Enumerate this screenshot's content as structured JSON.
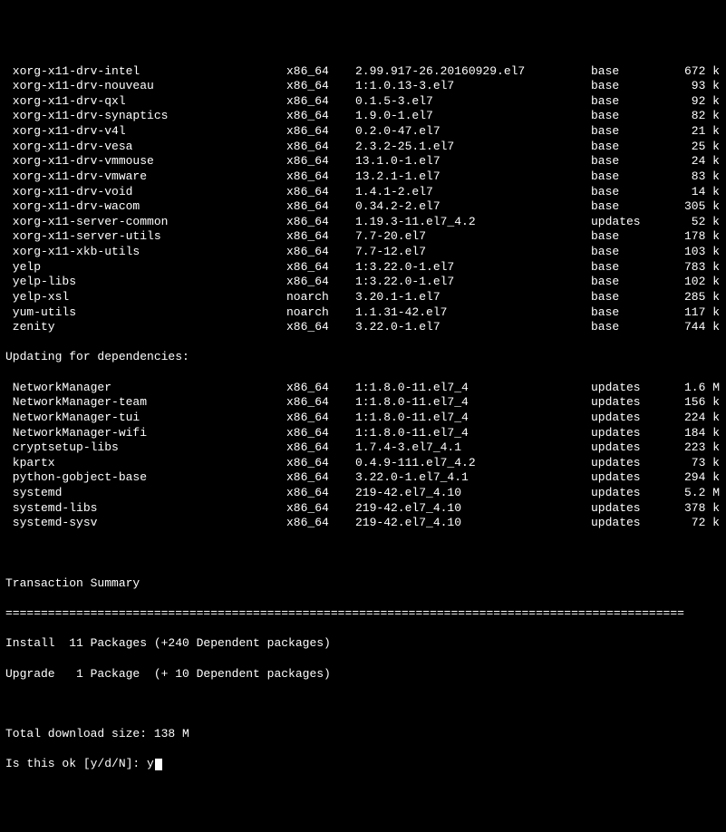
{
  "packages": [
    {
      "name": " xorg-x11-drv-intel",
      "arch": "x86_64",
      "ver": "2.99.917-26.20160929.el7",
      "repo": "base",
      "size": "672 k"
    },
    {
      "name": " xorg-x11-drv-nouveau",
      "arch": "x86_64",
      "ver": "1:1.0.13-3.el7",
      "repo": "base",
      "size": "93 k"
    },
    {
      "name": " xorg-x11-drv-qxl",
      "arch": "x86_64",
      "ver": "0.1.5-3.el7",
      "repo": "base",
      "size": "92 k"
    },
    {
      "name": " xorg-x11-drv-synaptics",
      "arch": "x86_64",
      "ver": "1.9.0-1.el7",
      "repo": "base",
      "size": "82 k"
    },
    {
      "name": " xorg-x11-drv-v4l",
      "arch": "x86_64",
      "ver": "0.2.0-47.el7",
      "repo": "base",
      "size": "21 k"
    },
    {
      "name": " xorg-x11-drv-vesa",
      "arch": "x86_64",
      "ver": "2.3.2-25.1.el7",
      "repo": "base",
      "size": "25 k"
    },
    {
      "name": " xorg-x11-drv-vmmouse",
      "arch": "x86_64",
      "ver": "13.1.0-1.el7",
      "repo": "base",
      "size": "24 k"
    },
    {
      "name": " xorg-x11-drv-vmware",
      "arch": "x86_64",
      "ver": "13.2.1-1.el7",
      "repo": "base",
      "size": "83 k"
    },
    {
      "name": " xorg-x11-drv-void",
      "arch": "x86_64",
      "ver": "1.4.1-2.el7",
      "repo": "base",
      "size": "14 k"
    },
    {
      "name": " xorg-x11-drv-wacom",
      "arch": "x86_64",
      "ver": "0.34.2-2.el7",
      "repo": "base",
      "size": "305 k"
    },
    {
      "name": " xorg-x11-server-common",
      "arch": "x86_64",
      "ver": "1.19.3-11.el7_4.2",
      "repo": "updates",
      "size": "52 k"
    },
    {
      "name": " xorg-x11-server-utils",
      "arch": "x86_64",
      "ver": "7.7-20.el7",
      "repo": "base",
      "size": "178 k"
    },
    {
      "name": " xorg-x11-xkb-utils",
      "arch": "x86_64",
      "ver": "7.7-12.el7",
      "repo": "base",
      "size": "103 k"
    },
    {
      "name": " yelp",
      "arch": "x86_64",
      "ver": "1:3.22.0-1.el7",
      "repo": "base",
      "size": "783 k"
    },
    {
      "name": " yelp-libs",
      "arch": "x86_64",
      "ver": "1:3.22.0-1.el7",
      "repo": "base",
      "size": "102 k"
    },
    {
      "name": " yelp-xsl",
      "arch": "noarch",
      "ver": "3.20.1-1.el7",
      "repo": "base",
      "size": "285 k"
    },
    {
      "name": " yum-utils",
      "arch": "noarch",
      "ver": "1.1.31-42.el7",
      "repo": "base",
      "size": "117 k"
    },
    {
      "name": " zenity",
      "arch": "x86_64",
      "ver": "3.22.0-1.el7",
      "repo": "base",
      "size": "744 k"
    }
  ],
  "dep_header": "Updating for dependencies:",
  "deps": [
    {
      "name": " NetworkManager",
      "arch": "x86_64",
      "ver": "1:1.8.0-11.el7_4",
      "repo": "updates",
      "size": "1.6 M"
    },
    {
      "name": " NetworkManager-team",
      "arch": "x86_64",
      "ver": "1:1.8.0-11.el7_4",
      "repo": "updates",
      "size": "156 k"
    },
    {
      "name": " NetworkManager-tui",
      "arch": "x86_64",
      "ver": "1:1.8.0-11.el7_4",
      "repo": "updates",
      "size": "224 k"
    },
    {
      "name": " NetworkManager-wifi",
      "arch": "x86_64",
      "ver": "1:1.8.0-11.el7_4",
      "repo": "updates",
      "size": "184 k"
    },
    {
      "name": " cryptsetup-libs",
      "arch": "x86_64",
      "ver": "1.7.4-3.el7_4.1",
      "repo": "updates",
      "size": "223 k"
    },
    {
      "name": " kpartx",
      "arch": "x86_64",
      "ver": "0.4.9-111.el7_4.2",
      "repo": "updates",
      "size": "73 k"
    },
    {
      "name": " python-gobject-base",
      "arch": "x86_64",
      "ver": "3.22.0-1.el7_4.1",
      "repo": "updates",
      "size": "294 k"
    },
    {
      "name": " systemd",
      "arch": "x86_64",
      "ver": "219-42.el7_4.10",
      "repo": "updates",
      "size": "5.2 M"
    },
    {
      "name": " systemd-libs",
      "arch": "x86_64",
      "ver": "219-42.el7_4.10",
      "repo": "updates",
      "size": "378 k"
    },
    {
      "name": " systemd-sysv",
      "arch": "x86_64",
      "ver": "219-42.el7_4.10",
      "repo": "updates",
      "size": "72 k"
    }
  ],
  "summary_header": "Transaction Summary",
  "divider": "================================================================================================",
  "summary_lines": {
    "install": "Install  11 Packages (+240 Dependent packages)",
    "upgrade": "Upgrade   1 Package  (+ 10 Dependent packages)"
  },
  "download_size": "Total download size: 138 M",
  "prompt": "Is this ok [y/d/N]: ",
  "answer": "y"
}
